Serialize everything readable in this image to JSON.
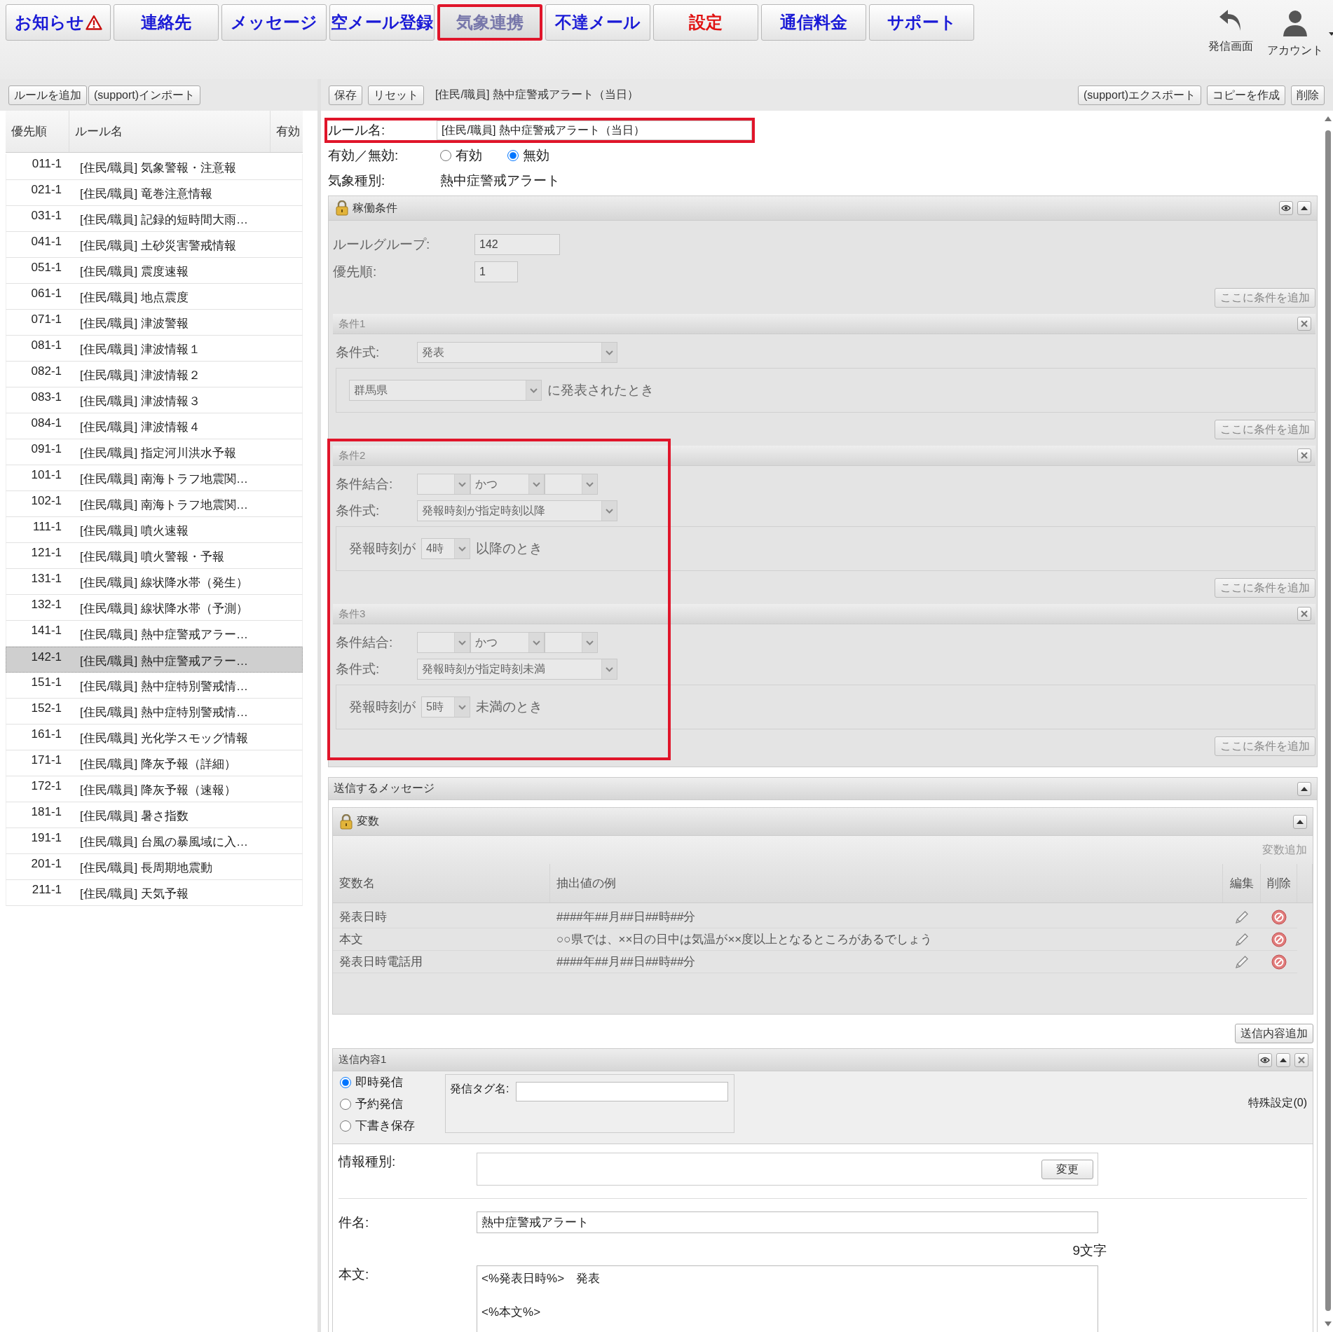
{
  "nav": {
    "tabs": [
      {
        "label": "お知らせ",
        "kind": "notice",
        "selected": false
      },
      {
        "label": "連絡先",
        "kind": "plain",
        "selected": false
      },
      {
        "label": "メッセージ",
        "kind": "plain",
        "selected": false
      },
      {
        "label": "空メール登録",
        "kind": "plain",
        "selected": false
      },
      {
        "label": "気象連携",
        "kind": "plain",
        "selected": true
      },
      {
        "label": "不達メール",
        "kind": "plain",
        "selected": false
      },
      {
        "label": "設定",
        "kind": "alert",
        "selected": false
      },
      {
        "label": "通信料金",
        "kind": "plain",
        "selected": false
      },
      {
        "label": "サポート",
        "kind": "plain",
        "selected": false
      }
    ],
    "actions": [
      {
        "label": "発信画面",
        "kind": "back"
      },
      {
        "label": "アカウント",
        "kind": "account"
      }
    ]
  },
  "rule_list": {
    "toolbar": [
      "ルールを追加",
      "(support)インポート"
    ],
    "columns": [
      "優先順",
      "ルール名",
      "有効"
    ],
    "rows": [
      {
        "priority": "011-1",
        "name": "[住民/職員] 気象警報・注意報",
        "selected": false
      },
      {
        "priority": "021-1",
        "name": "[住民/職員] 竜巻注意情報",
        "selected": false
      },
      {
        "priority": "031-1",
        "name": "[住民/職員] 記録的短時間大雨…",
        "selected": false
      },
      {
        "priority": "041-1",
        "name": "[住民/職員] 土砂災害警戒情報",
        "selected": false
      },
      {
        "priority": "051-1",
        "name": "[住民/職員] 震度速報",
        "selected": false
      },
      {
        "priority": "061-1",
        "name": "[住民/職員] 地点震度",
        "selected": false
      },
      {
        "priority": "071-1",
        "name": "[住民/職員] 津波警報",
        "selected": false
      },
      {
        "priority": "081-1",
        "name": "[住民/職員] 津波情報１",
        "selected": false
      },
      {
        "priority": "082-1",
        "name": "[住民/職員] 津波情報２",
        "selected": false
      },
      {
        "priority": "083-1",
        "name": "[住民/職員] 津波情報３",
        "selected": false
      },
      {
        "priority": "084-1",
        "name": "[住民/職員] 津波情報４",
        "selected": false
      },
      {
        "priority": "091-1",
        "name": "[住民/職員] 指定河川洪水予報",
        "selected": false
      },
      {
        "priority": "101-1",
        "name": "[住民/職員] 南海トラフ地震関…",
        "selected": false
      },
      {
        "priority": "102-1",
        "name": "[住民/職員] 南海トラフ地震関…",
        "selected": false
      },
      {
        "priority": "111-1",
        "name": "[住民/職員] 噴火速報",
        "selected": false
      },
      {
        "priority": "121-1",
        "name": "[住民/職員] 噴火警報・予報",
        "selected": false
      },
      {
        "priority": "131-1",
        "name": "[住民/職員] 線状降水帯（発生）",
        "selected": false
      },
      {
        "priority": "132-1",
        "name": "[住民/職員] 線状降水帯（予測）",
        "selected": false
      },
      {
        "priority": "141-1",
        "name": "[住民/職員] 熱中症警戒アラー…",
        "selected": false
      },
      {
        "priority": "142-1",
        "name": "[住民/職員] 熱中症警戒アラー…",
        "selected": true
      },
      {
        "priority": "151-1",
        "name": "[住民/職員] 熱中症特別警戒情…",
        "selected": false
      },
      {
        "priority": "152-1",
        "name": "[住民/職員] 熱中症特別警戒情…",
        "selected": false
      },
      {
        "priority": "161-1",
        "name": "[住民/職員] 光化学スモッグ情報",
        "selected": false
      },
      {
        "priority": "171-1",
        "name": "[住民/職員] 降灰予報（詳細）",
        "selected": false
      },
      {
        "priority": "172-1",
        "name": "[住民/職員] 降灰予報（速報）",
        "selected": false
      },
      {
        "priority": "181-1",
        "name": "[住民/職員] 暑さ指数",
        "selected": false
      },
      {
        "priority": "191-1",
        "name": "[住民/職員] 台風の暴風域に入…",
        "selected": false
      },
      {
        "priority": "201-1",
        "name": "[住民/職員] 長周期地震動",
        "selected": false
      },
      {
        "priority": "211-1",
        "name": "[住民/職員] 天気予報",
        "selected": false
      }
    ]
  },
  "editor": {
    "toolbar_left": [
      "保存",
      "リセット"
    ],
    "title": "[住民/職員] 熱中症警戒アラート（当日）",
    "toolbar_right": [
      "(support)エクスポート",
      "コピーを作成",
      "削除"
    ],
    "rule_name": {
      "label": "ルール名:",
      "value": "[住民/職員] 熱中症警戒アラート（当日）",
      "highlighted": true
    },
    "enabled": {
      "label": "有効／無効:",
      "options": [
        {
          "label": "有効",
          "selected": false
        },
        {
          "label": "無効",
          "selected": true
        }
      ]
    },
    "weather_type": {
      "label": "気象種別:",
      "value": "熱中症警戒アラート"
    },
    "operating_conditions": {
      "title": "稼働条件",
      "group": {
        "label": "ルールグループ:",
        "value": "142"
      },
      "priority": {
        "label": "優先順:",
        "value": "1"
      },
      "add_button": "ここに条件を追加",
      "conditions": [
        {
          "title": "条件1",
          "highlighted": false,
          "expression": {
            "label": "条件式:",
            "value": "発表"
          },
          "detail": {
            "select": "群馬県",
            "suffix": "に発表されたとき"
          },
          "add_button": "ここに条件を追加"
        },
        {
          "title": "条件2",
          "highlighted": true,
          "combine": {
            "label": "条件結合:",
            "operator": "かつ"
          },
          "expression": {
            "label": "条件式:",
            "value": "発報時刻が指定時刻以降"
          },
          "detail": {
            "prefix": "発報時刻が",
            "select": "4時",
            "suffix": "以降のとき"
          },
          "add_button": "ここに条件を追加"
        },
        {
          "title": "条件3",
          "highlighted": true,
          "combine": {
            "label": "条件結合:",
            "operator": "かつ"
          },
          "expression": {
            "label": "条件式:",
            "value": "発報時刻が指定時刻未満"
          },
          "detail": {
            "prefix": "発報時刻が",
            "select": "5時",
            "suffix": "未満のとき"
          },
          "add_button": "ここに条件を追加"
        }
      ]
    },
    "message": {
      "title": "送信するメッセージ",
      "variables": {
        "title": "変数",
        "add_link": "変数追加",
        "columns": [
          "変数名",
          "抽出値の例",
          "編集",
          "削除"
        ],
        "rows": [
          {
            "name": "発表日時",
            "example": "####年##月##日##時##分"
          },
          {
            "name": "本文",
            "example": "○○県では、××日の日中は気温が××度以上となるところがあるでしょう"
          },
          {
            "name": "発表日時電話用",
            "example": "####年##月##日##時##分"
          }
        ]
      },
      "add_content_button": "送信内容追加",
      "content": {
        "title": "送信内容1",
        "timing": [
          {
            "label": "即時発信",
            "selected": true
          },
          {
            "label": "予約発信",
            "selected": false
          },
          {
            "label": "下書き保存",
            "selected": false
          }
        ],
        "tag_label": "発信タグ名:",
        "special": "特殊設定(0)",
        "info_type": {
          "label": "情報種別:",
          "button": "変更"
        },
        "subject": {
          "label": "件名:",
          "value": "熱中症警戒アラート"
        },
        "count": "9文字",
        "body": {
          "label": "本文:",
          "value": "<%発表日時%>　発表\n\n<%本文%>"
        }
      }
    }
  }
}
